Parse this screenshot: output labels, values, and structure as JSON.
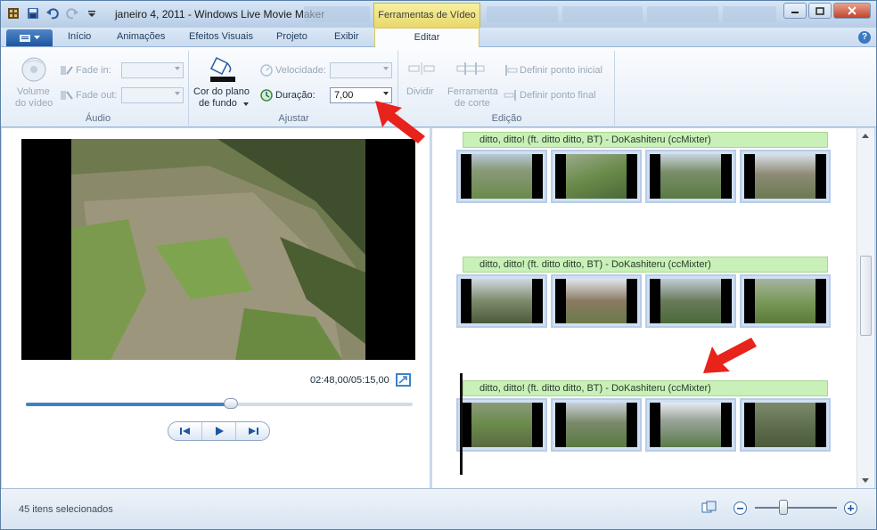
{
  "window": {
    "title": "janeiro 4, 2011 - Windows Live Movie Maker",
    "context_tab_title": "Ferramentas de Vídeo"
  },
  "tabs": [
    {
      "label": "Início",
      "active": false
    },
    {
      "label": "Animações",
      "active": false
    },
    {
      "label": "Efeitos Visuais",
      "active": false
    },
    {
      "label": "Projeto",
      "active": false
    },
    {
      "label": "Exibir",
      "active": false
    },
    {
      "label": "Editar",
      "active": true
    }
  ],
  "help_label": "?",
  "ribbon": {
    "audio": {
      "group_label": "Áudio",
      "volume_label_1": "Volume",
      "volume_label_2": "do vídeo",
      "fade_in_label": "Fade in:",
      "fade_out_label": "Fade out:"
    },
    "ajustar": {
      "group_label": "Ajustar",
      "bg_color_label_1": "Cor do plano",
      "bg_color_label_2": "de fundo",
      "speed_label": "Velocidade:",
      "duration_label": "Duração:",
      "duration_value": "7,00"
    },
    "edicao": {
      "group_label": "Edição",
      "split_label": "Dividir",
      "trim_label_1": "Ferramenta",
      "trim_label_2": "de corte",
      "set_start_label": "Definir ponto inicial",
      "set_end_label": "Definir ponto final"
    }
  },
  "player": {
    "timecode": "02:48,00/05:15,00",
    "progress_fraction": 0.53
  },
  "storyboard": {
    "audio_track_label": "ditto, ditto! (ft. ditto ditto, BT) - DoKashiteru (ccMixter)",
    "rows": [
      {
        "audio": "ditto, ditto! (ft. ditto ditto, BT) - DoKashiteru (ccMixter)"
      },
      {
        "audio": "ditto, ditto! (ft. ditto ditto, BT) - DoKashiteru (ccMixter)"
      },
      {
        "audio": "ditto, ditto! (ft. ditto ditto, BT) - DoKashiteru (ccMixter)"
      }
    ]
  },
  "status": {
    "selection_text": "45 itens selecionados",
    "zoom_fraction": 0.35
  },
  "colors": {
    "accent": "#3d82c9",
    "context_tab": "#e8d86a",
    "audio_track": "#c9f0b8",
    "annotation_arrow": "#e8231c"
  }
}
